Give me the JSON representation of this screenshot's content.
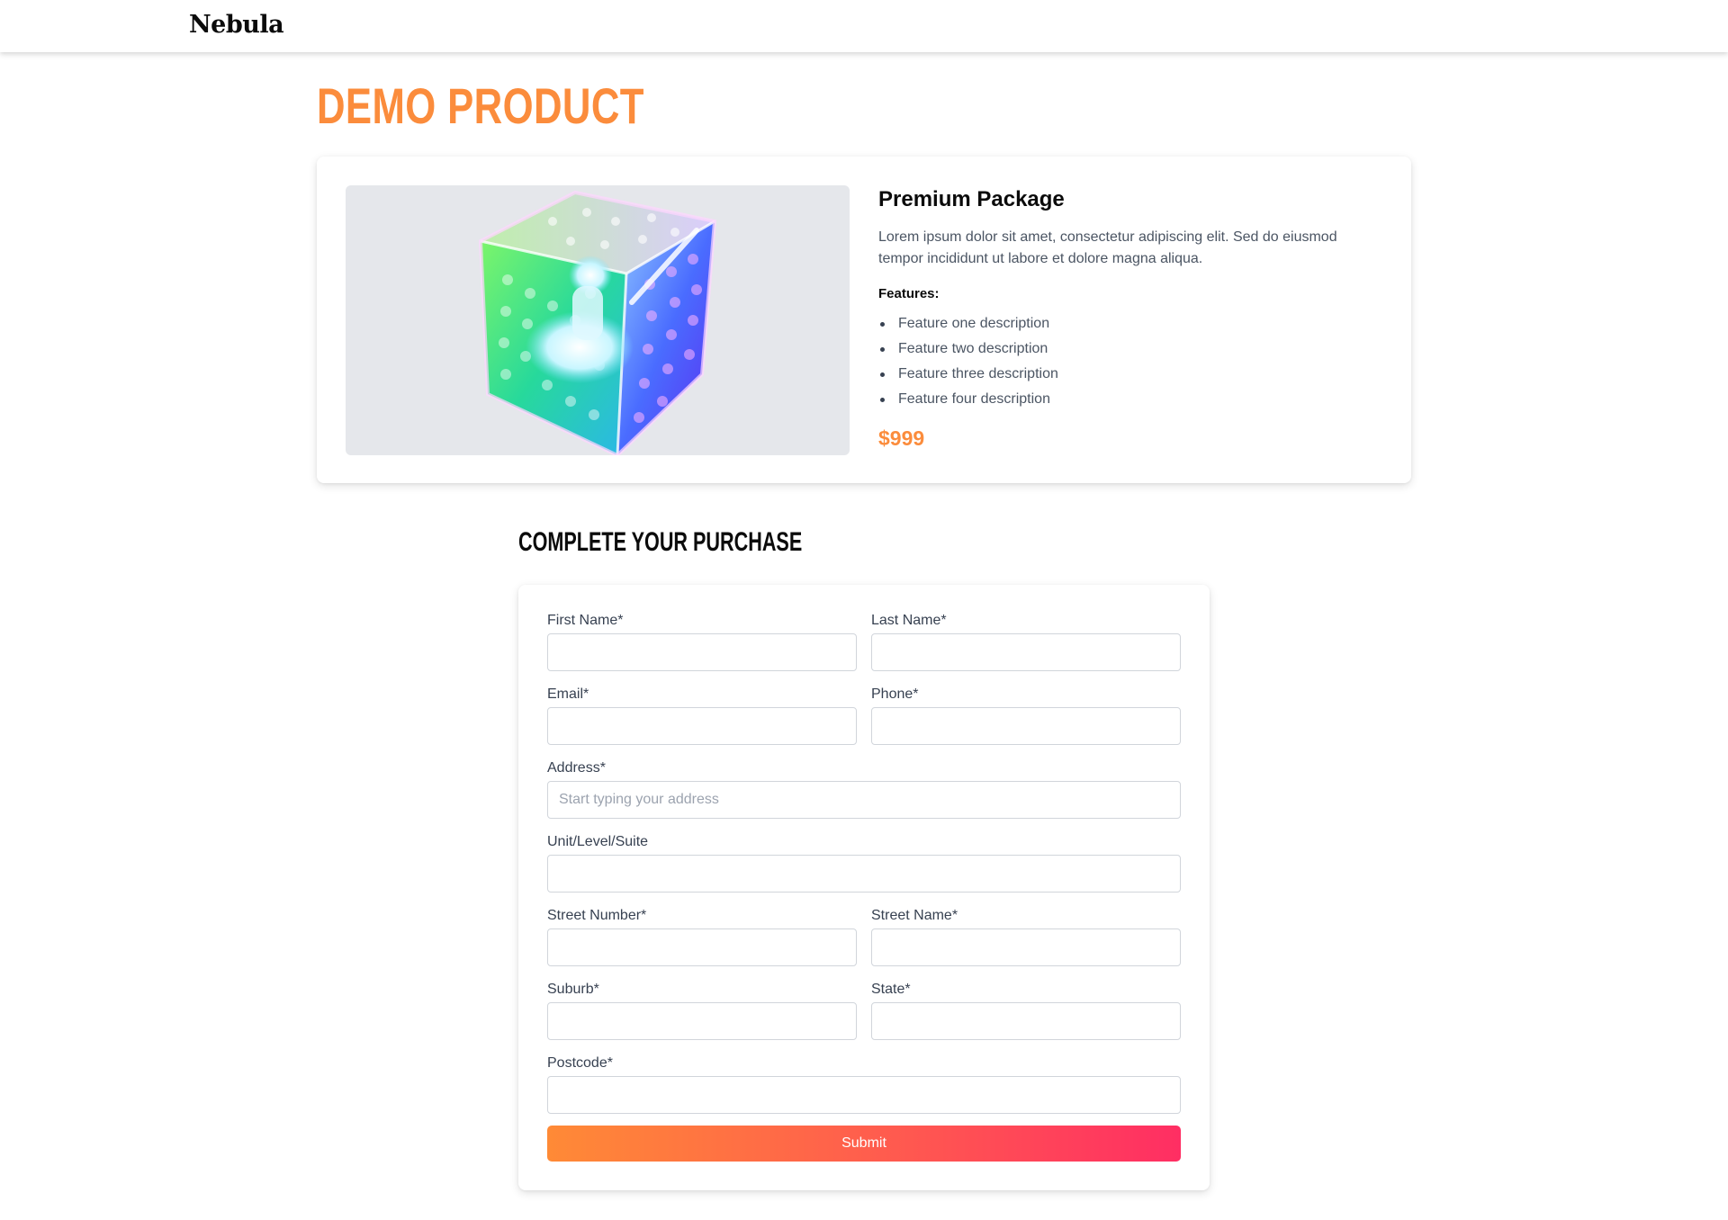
{
  "header": {
    "brand": "Nebula"
  },
  "page": {
    "title": "DEMO PRODUCT"
  },
  "product": {
    "name": "Premium Package",
    "description": "Lorem ipsum dolor sit amet, consectetur adipiscing elit. Sed do eiusmod tempor incididunt ut labore et dolore magna aliqua.",
    "features_heading": "Features:",
    "features": [
      "Feature one description",
      "Feature two description",
      "Feature three description",
      "Feature four description"
    ],
    "price": "$999"
  },
  "purchase": {
    "title": "COMPLETE YOUR PURCHASE",
    "fields": {
      "first_name": {
        "label": "First Name*",
        "value": "",
        "placeholder": ""
      },
      "last_name": {
        "label": "Last Name*",
        "value": "",
        "placeholder": ""
      },
      "email": {
        "label": "Email*",
        "value": "",
        "placeholder": ""
      },
      "phone": {
        "label": "Phone*",
        "value": "",
        "placeholder": ""
      },
      "address": {
        "label": "Address*",
        "value": "",
        "placeholder": "Start typing your address"
      },
      "unit": {
        "label": "Unit/Level/Suite",
        "value": "",
        "placeholder": ""
      },
      "street_number": {
        "label": "Street Number*",
        "value": "",
        "placeholder": ""
      },
      "street_name": {
        "label": "Street Name*",
        "value": "",
        "placeholder": ""
      },
      "suburb": {
        "label": "Suburb*",
        "value": "",
        "placeholder": ""
      },
      "state": {
        "label": "State*",
        "value": "",
        "placeholder": ""
      },
      "postcode": {
        "label": "Postcode*",
        "value": "",
        "placeholder": ""
      }
    },
    "submit_label": "Submit"
  },
  "colors": {
    "accent": "#fb8c3c",
    "gradient_start": "#ff8a36",
    "gradient_end": "#ff2e63"
  }
}
